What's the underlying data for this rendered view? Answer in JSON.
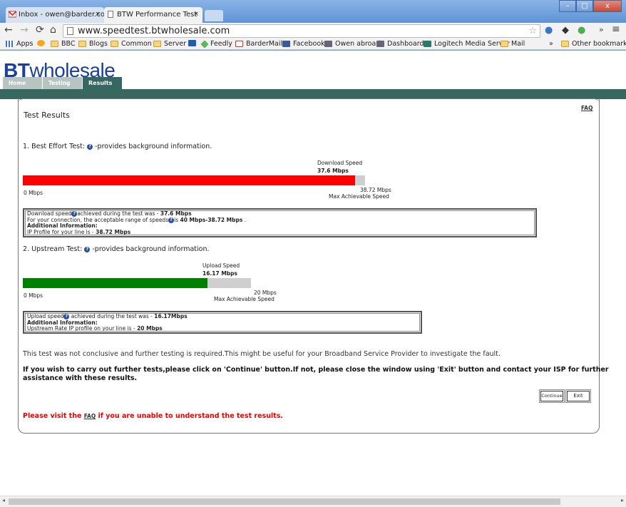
{
  "browser": {
    "tabs": [
      {
        "title": "Inbox - owen@barder.com",
        "close": "×"
      },
      {
        "title": "BTW Performance Test",
        "close": "×"
      }
    ],
    "window_buttons": {
      "minimize": "–",
      "maximize": "□",
      "close": "x"
    },
    "address": "www.speedtest.btwholesale.com",
    "overflow": "»",
    "menu": "≡",
    "bookmarks": [
      {
        "label": "Apps",
        "icon": "apps-grid-icon"
      },
      {
        "label": "",
        "icon": "people-icon"
      },
      {
        "label": "BBC",
        "icon": "folder-icon"
      },
      {
        "label": "Blogs",
        "icon": "folder-icon"
      },
      {
        "label": "Common",
        "icon": "folder-icon"
      },
      {
        "label": "Server",
        "icon": "folder-icon"
      },
      {
        "label": "",
        "icon": "twitter-icon"
      },
      {
        "label": "Feedly",
        "icon": "feedly-icon"
      },
      {
        "label": "BarderMail",
        "icon": "gmail-icon"
      },
      {
        "label": "Facebook",
        "icon": "facebook-icon"
      },
      {
        "label": "Owen abroad",
        "icon": "site-icon"
      },
      {
        "label": "Dashboard",
        "icon": "site-icon"
      },
      {
        "label": "Logitech Media Server",
        "icon": "site-icon"
      },
      {
        "label": "Mail",
        "icon": "folder-icon"
      }
    ],
    "bookmarks_overflow": "»",
    "other_bookmarks": "Other bookmarks"
  },
  "site": {
    "logo_bt": "BT",
    "logo_wholesale": "wholesale",
    "nav": [
      {
        "label": "Home",
        "active": false
      },
      {
        "label": "Testing",
        "active": false
      },
      {
        "label": "Results",
        "active": true
      }
    ]
  },
  "results": {
    "title": "Test Results",
    "faq": "FAQ",
    "best_effort": {
      "heading": "1. Best Effort Test:",
      "heading_suffix": "-provides background information.",
      "label": "Download Speed",
      "value_label": "37.6 Mbps",
      "min_label": "0 Mbps",
      "max_value_label": "38.72 Mbps",
      "max_label": "Max Achievable Speed",
      "fraction": 0.971,
      "color": "#ff0000",
      "info": {
        "l1a": "Download speed",
        "l1b": "achieved during the test was - ",
        "l1c": "37.6 Mbps",
        "l2a": "For your connection, the acceptable range of speeds",
        "l2b": "is ",
        "l2c": "40 Mbps-38.72 Mbps",
        "l2d": " .",
        "l3": "Additional Information:",
        "l4a": "IP Profile for your line is - ",
        "l4b": "38.72 Mbps"
      }
    },
    "upstream": {
      "heading": "2. Upstream Test:",
      "heading_suffix": "-provides background information.",
      "label": "Upload Speed",
      "value_label": "16.17 Mbps",
      "min_label": "0 Mbps",
      "max_value_label": "20 Mbps",
      "max_label": "Max Achievable Speed",
      "fraction": 0.8085,
      "color": "#008000",
      "info": {
        "l1a": "Upload speed",
        "l1b": " achieved during the test was - ",
        "l1c": "16.17Mbps",
        "l3": "Additional Information:",
        "l4a": "Upstream Rate IP profile on your line is - ",
        "l4b": "20 Mbps"
      }
    },
    "conclusion": "This test was not conclusive and further testing is required.This might be useful for your Broadband Service Provider to investigate the fault.",
    "instruction_1": "If you wish to carry out further tests,please click on 'Continue' button.If not, please close the window using 'Exit' button and contact your ISP for further",
    "instruction_2": "assistance with these results.",
    "continue_label": "Continue",
    "exit_label": "Exit",
    "faq_note_pre": "Please visit the ",
    "faq_note_link": "FAQ",
    "faq_note_post": " if you are unable to understand the test results.",
    "help_glyph": "?"
  }
}
